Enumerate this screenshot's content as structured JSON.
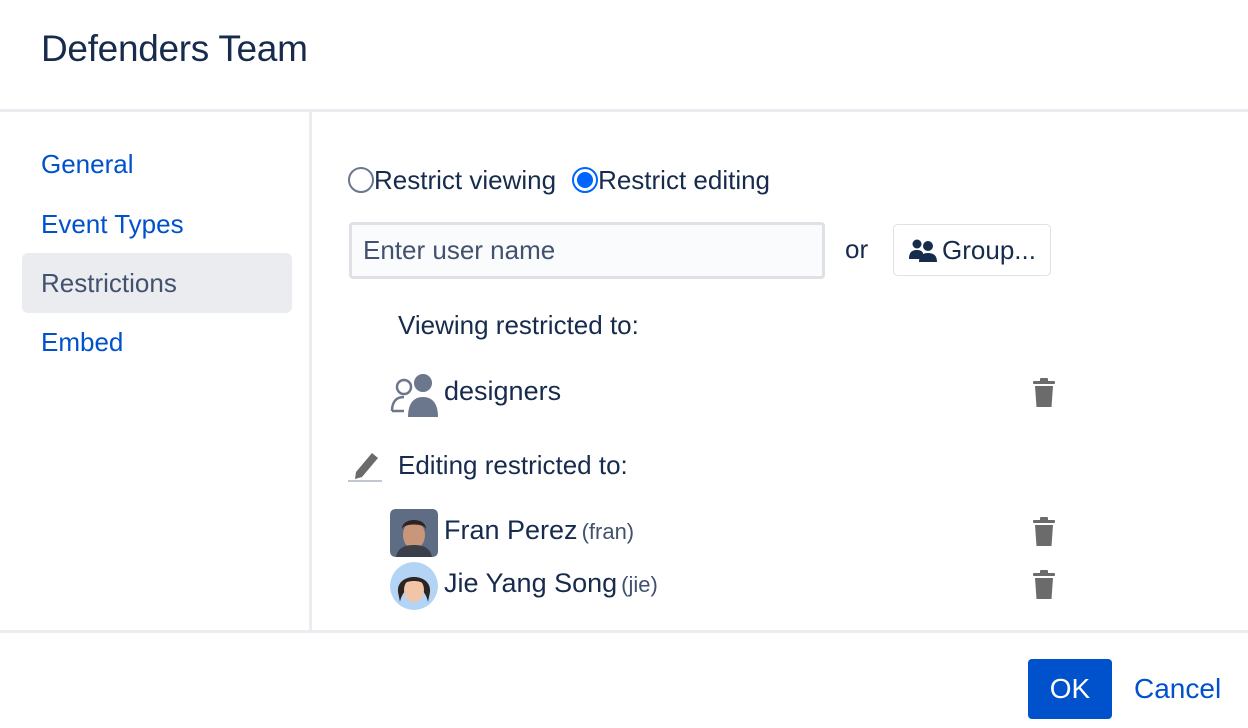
{
  "dialog": {
    "title": "Defenders Team"
  },
  "sidebar": {
    "items": [
      {
        "label": "General",
        "active": false
      },
      {
        "label": "Event Types",
        "active": false
      },
      {
        "label": "Restrictions",
        "active": true
      },
      {
        "label": "Embed",
        "active": false
      }
    ]
  },
  "restrictions": {
    "mode_options": [
      {
        "label": "Restrict viewing",
        "selected": false
      },
      {
        "label": "Restrict editing",
        "selected": true
      }
    ],
    "user_input": {
      "value": "",
      "placeholder": "Enter user name"
    },
    "or_text": "or",
    "group_button_label": "Group...",
    "viewing_heading": "Viewing restricted to:",
    "viewing_entries": [
      {
        "name": "designers",
        "type": "group",
        "icon": "group-icon"
      }
    ],
    "editing_heading": "Editing restricted to:",
    "editing_entries": [
      {
        "name": "Fran Perez",
        "username": "(fran)",
        "type": "user",
        "icon": "avatar"
      },
      {
        "name": "Jie Yang Song",
        "username": "(jie)",
        "type": "user",
        "icon": "avatar"
      }
    ]
  },
  "footer": {
    "ok_label": "OK",
    "cancel_label": "Cancel"
  },
  "colors": {
    "link": "#0052cc",
    "primary_button": "#0052cc",
    "text": "#172b4d",
    "active_nav_bg": "#ebecf0",
    "radio_selected": "#0065ff"
  }
}
